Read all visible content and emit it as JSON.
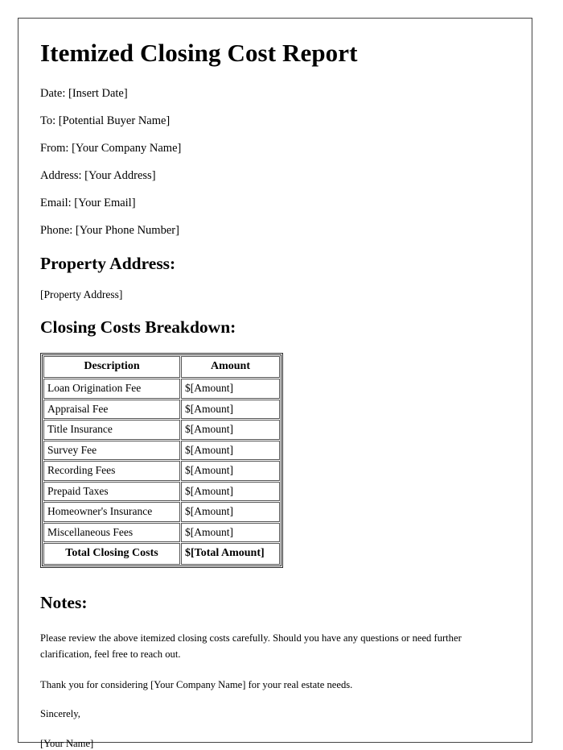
{
  "document": {
    "title": "Itemized Closing Cost Report",
    "meta_lines": [
      "Date: [Insert Date]",
      "To: [Potential Buyer Name]",
      "From: [Your Company Name]",
      "Address: [Your Address]",
      "Email: [Your Email]",
      "Phone: [Your Phone Number]"
    ],
    "property_section": {
      "heading": "Property Address:",
      "value": "[Property Address]"
    },
    "breakdown_section": {
      "heading": "Closing Costs Breakdown:",
      "table": {
        "columns": [
          "Description",
          "Amount"
        ],
        "rows": [
          {
            "description": "Loan Origination Fee",
            "amount": "$[Amount]"
          },
          {
            "description": "Appraisal Fee",
            "amount": "$[Amount]"
          },
          {
            "description": "Title Insurance",
            "amount": "$[Amount]"
          },
          {
            "description": "Survey Fee",
            "amount": "$[Amount]"
          },
          {
            "description": "Recording Fees",
            "amount": "$[Amount]"
          },
          {
            "description": "Prepaid Taxes",
            "amount": "$[Amount]"
          },
          {
            "description": "Homeowner's Insurance",
            "amount": "$[Amount]"
          },
          {
            "description": "Miscellaneous Fees",
            "amount": "$[Amount]"
          }
        ],
        "total_row": {
          "description": "Total Closing Costs",
          "amount": "$[Total Amount]"
        }
      }
    },
    "notes_section": {
      "heading": "Notes:",
      "paragraph": "Please review the above itemized closing costs carefully. Should you have any questions or need further clarification, feel free to reach out.",
      "thank_you": "Thank you for considering [Your Company Name] for your real estate needs.",
      "sign_off": "Sincerely,",
      "signature_name": "[Your Name]"
    }
  },
  "colors": {
    "page_background": "#ffffff",
    "text": "#000000",
    "page_border": "#444444",
    "table_border": "#2b2b2b",
    "cell_border": "#555555"
  }
}
